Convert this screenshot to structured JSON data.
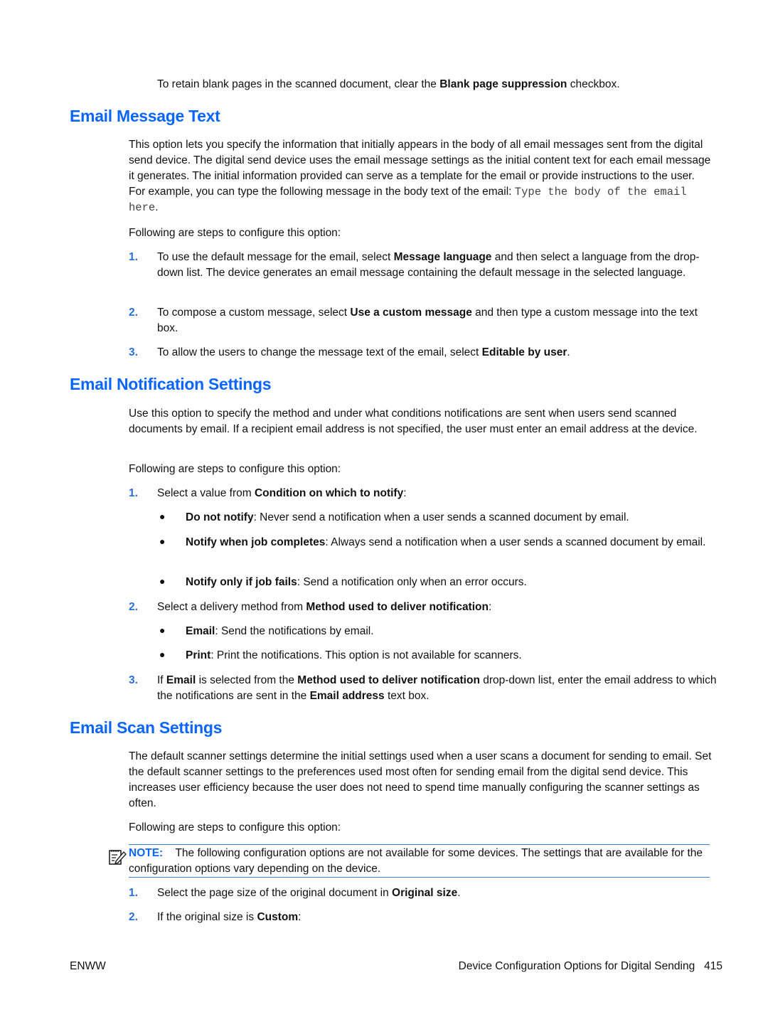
{
  "intro": {
    "pre": "To retain blank pages in the scanned document, clear the ",
    "bold": "Blank page suppression",
    "post": " checkbox."
  },
  "sections": {
    "message_text": {
      "heading": "Email Message Text",
      "paragraph": "This option lets you specify the information that initially appears in the body of all email messages sent from the digital send device. The digital send device uses the email message settings as the initial content text for each email message it generates. The initial information provided can serve as a template for the email or provide instructions to the user. For example, you can type the following message in the body text of the email: ",
      "example_mono": "Type the body of the email here",
      "example_end": ".",
      "steps_intro": "Following are steps to configure this option:",
      "steps": [
        {
          "num": "1.",
          "pre": "To use the default message for the email, select ",
          "bold": "Message language",
          "post": " and then select a language from the drop-down list. The device generates an email message containing the default message in the selected language."
        },
        {
          "num": "2.",
          "pre": "To compose a custom message, select ",
          "bold": "Use a custom message",
          "post": " and then type a custom message into the text box."
        },
        {
          "num": "3.",
          "pre": "To allow the users to change the message text of the email, select ",
          "bold": "Editable by user",
          "post": "."
        }
      ]
    },
    "notification": {
      "heading": "Email Notification Settings",
      "paragraph": "Use this option to specify the method and under what conditions notifications are sent when users send scanned documents by email. If a recipient email address is not specified, the user must enter an email address at the device.",
      "steps_intro": "Following are steps to configure this option:",
      "step1": {
        "num": "1.",
        "pre": "Select a value from ",
        "bold": "Condition on which to notify",
        "post": ":"
      },
      "step1_bullets": [
        {
          "bold": "Do not notify",
          "post": ": Never send a notification when a user sends a scanned document by email."
        },
        {
          "bold": "Notify when job completes",
          "post": ": Always send a notification when a user sends a scanned document by email."
        },
        {
          "bold": "Notify only if job fails",
          "post": ": Send a notification only when an error occurs."
        }
      ],
      "step2": {
        "num": "2.",
        "pre": "Select a delivery method from ",
        "bold": "Method used to deliver notification",
        "post": ":"
      },
      "step2_bullets": [
        {
          "bold": "Email",
          "post": ": Send the notifications by email."
        },
        {
          "bold": "Print",
          "post": ": Print the notifications. This option is not available for scanners."
        }
      ],
      "step3": {
        "num": "3.",
        "a": "If ",
        "b1": "Email",
        "c": " is selected from the ",
        "b2": "Method used to deliver notification",
        "d": " drop-down list, enter the email address to which the notifications are sent in the ",
        "b3": "Email address",
        "e": " text box."
      }
    },
    "scan": {
      "heading": "Email Scan Settings",
      "paragraph": "The default scanner settings determine the initial settings used when a user scans a document for sending to email. Set the default scanner settings to the preferences used most often for sending email from the digital send device. This increases user efficiency because the user does not need to spend time manually configuring the scanner settings as often.",
      "steps_intro": "Following are steps to configure this option:",
      "note": {
        "icon": "note-pencil-icon",
        "label": "NOTE:",
        "text": "The following configuration options are not available for some devices. The settings that are available for the configuration options vary depending on the device."
      },
      "steps": [
        {
          "num": "1.",
          "pre": "Select the page size of the original document in ",
          "bold": "Original size",
          "post": "."
        },
        {
          "num": "2.",
          "pre": "If the original size is ",
          "bold": "Custom",
          "post": ":"
        }
      ]
    }
  },
  "footer": {
    "left": "ENWW",
    "title": "Device Configuration Options for Digital Sending",
    "page": "415"
  }
}
